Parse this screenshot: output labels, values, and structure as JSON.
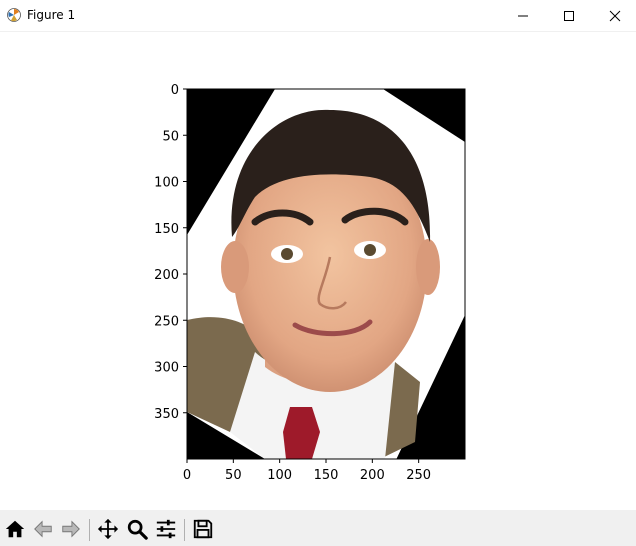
{
  "window": {
    "title": "Figure 1",
    "controls": [
      "minimize",
      "maximize",
      "close"
    ]
  },
  "figure": {
    "image_description_icon": "face-photo",
    "image_width": 300,
    "image_height": 400
  },
  "axes": {
    "x_ticks": [
      "0",
      "50",
      "100",
      "150",
      "200",
      "250"
    ],
    "x_values": [
      0,
      50,
      100,
      150,
      200,
      250
    ],
    "y_ticks": [
      "0",
      "50",
      "100",
      "150",
      "200",
      "250",
      "300",
      "350"
    ],
    "y_values": [
      0,
      50,
      100,
      150,
      200,
      250,
      300,
      350
    ],
    "xlim": [
      0,
      300
    ],
    "ylim": [
      400,
      0
    ]
  },
  "toolbar": {
    "buttons": [
      {
        "name": "home-icon",
        "tooltip": "Reset original view"
      },
      {
        "name": "back-icon",
        "tooltip": "Back"
      },
      {
        "name": "forward-icon",
        "tooltip": "Forward"
      },
      {
        "name": "pan-icon",
        "tooltip": "Pan"
      },
      {
        "name": "zoom-icon",
        "tooltip": "Zoom"
      },
      {
        "name": "configure-subplots-icon",
        "tooltip": "Configure subplots"
      },
      {
        "name": "save-icon",
        "tooltip": "Save"
      }
    ]
  }
}
